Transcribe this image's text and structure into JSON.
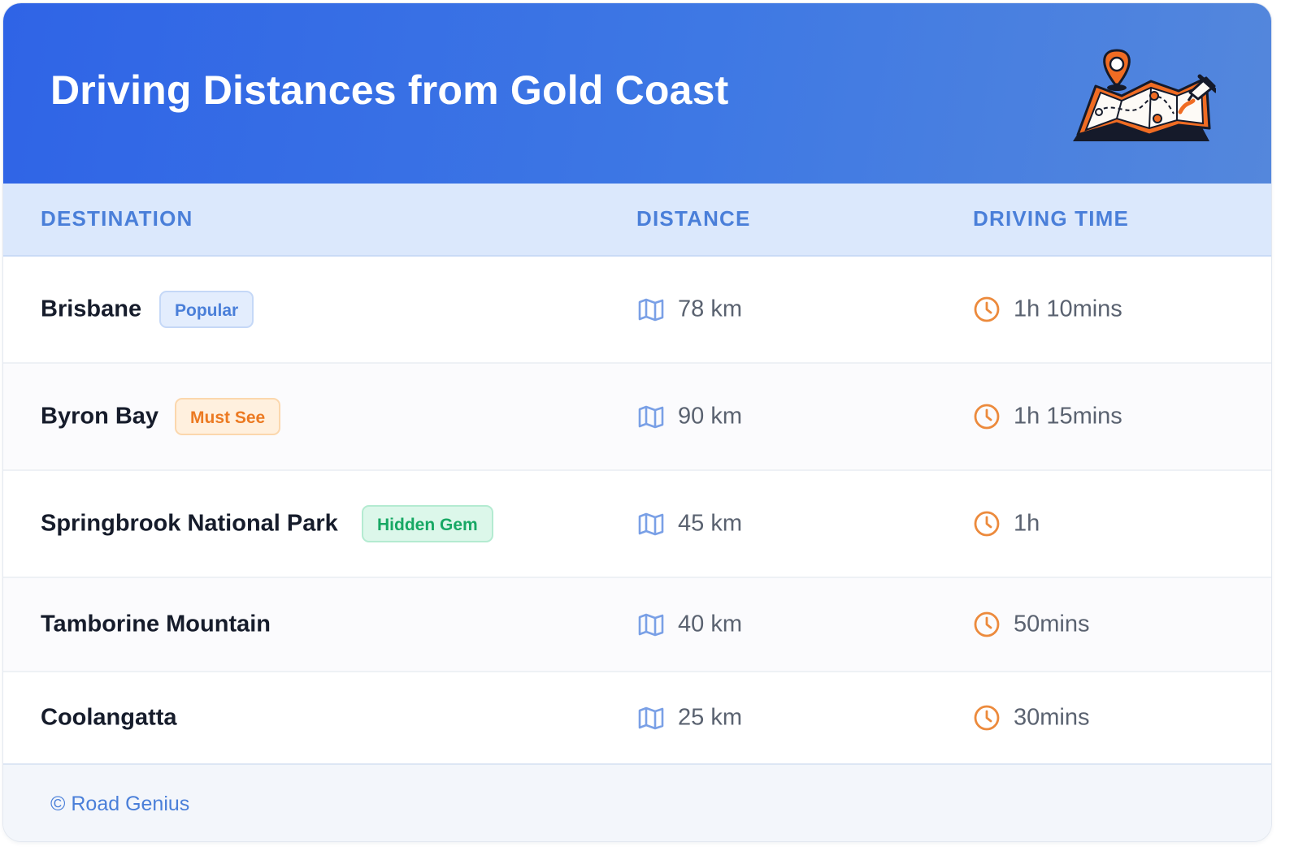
{
  "header": {
    "title": "Driving Distances from Gold Coast",
    "gradient_start": "#2f64e6",
    "gradient_end": "#5487dc"
  },
  "columns": {
    "destination": "DESTINATION",
    "distance": "DISTANCE",
    "driving_time": "DRIVING TIME"
  },
  "rows": [
    {
      "destination": "Brisbane",
      "badge": "Popular",
      "badge_color": "blue",
      "distance": "78 km",
      "time": "1h 10mins"
    },
    {
      "destination": "Byron Bay",
      "badge": "Must See",
      "badge_color": "orange",
      "distance": "90 km",
      "time": "1h 15mins"
    },
    {
      "destination": "Springbrook National Park",
      "badge": "Hidden Gem",
      "badge_color": "green",
      "distance": "45 km",
      "time": "1h"
    },
    {
      "destination": "Tamborine Mountain",
      "badge": "",
      "distance": "40 km",
      "time": "50mins"
    },
    {
      "destination": "Coolangatta",
      "badge": "",
      "distance": "25 km",
      "time": "30mins"
    }
  ],
  "icons": {
    "distance": "map-icon",
    "time": "clock-icon",
    "header": "map-with-pins-illustration"
  },
  "colors": {
    "accent_blue": "#4a7fd9",
    "accent_orange": "#ec8a3c",
    "green": "#17a864"
  },
  "footer": {
    "credit": "© Road Genius"
  }
}
